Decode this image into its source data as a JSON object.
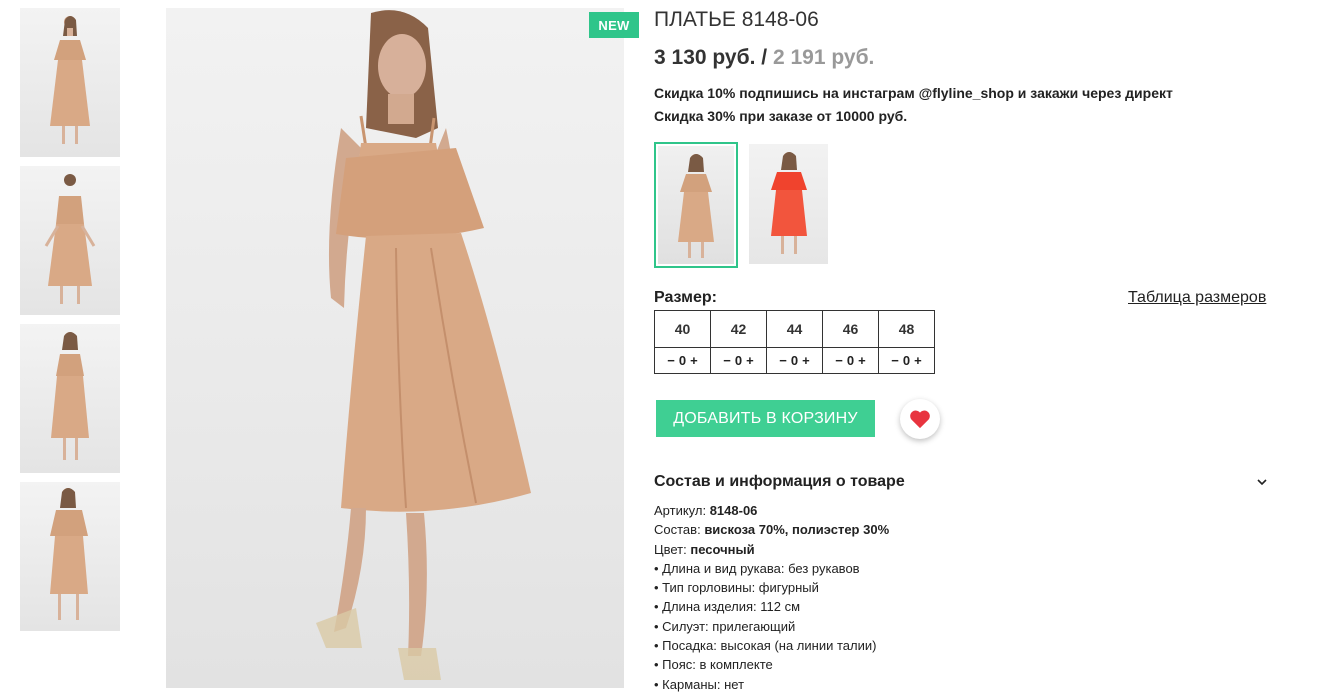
{
  "badge": "NEW",
  "product": {
    "title": "ПЛАТЬЕ 8148-06",
    "price_current": "3 130 руб.",
    "price_separator": "/",
    "price_old": "2 191 руб."
  },
  "promo": {
    "line1": "Скидка 10% подпишись на инстаграм @flyline_shop и закажи через директ",
    "line2": "Скидка 30% при заказе от 10000 руб."
  },
  "colors": {
    "options": [
      {
        "name": "beige",
        "hex": "#d9a986",
        "selected": true
      },
      {
        "name": "red",
        "hex": "#f0432d",
        "selected": false
      }
    ],
    "selected_border": "#2fc58a"
  },
  "sizes": {
    "label": "Размер:",
    "chart_link": "Таблица размеров",
    "items": [
      {
        "size": "40",
        "qty": "0"
      },
      {
        "size": "42",
        "qty": "0"
      },
      {
        "size": "44",
        "qty": "0"
      },
      {
        "size": "46",
        "qty": "0"
      },
      {
        "size": "48",
        "qty": "0"
      }
    ],
    "minus": "−",
    "plus": "+"
  },
  "actions": {
    "add_to_cart": "ДОБАВИТЬ В КОРЗИНУ",
    "favorite_icon": "heart-icon"
  },
  "details": {
    "heading": "Состав и информация о товаре",
    "article_label": "Артикул:",
    "article_value": "8148-06",
    "composition_label": "Состав:",
    "composition_value": "вискоза 70%, полиэстер 30%",
    "color_label": "Цвет:",
    "color_value": "песочный",
    "bullets": [
      "• Длина и вид рукава: без рукавов",
      "• Тип горловины: фигурный",
      "• Длина изделия: 112 см",
      "• Силуэт: прилегающий",
      "• Посадка: высокая (на линии талии)",
      "• Пояс: в комплекте",
      "• Карманы: нет"
    ]
  },
  "theme": {
    "accent": "#3fcf93",
    "dress_beige": "#d9a986",
    "dress_red": "#f0432d",
    "heart": "#e8343f"
  }
}
